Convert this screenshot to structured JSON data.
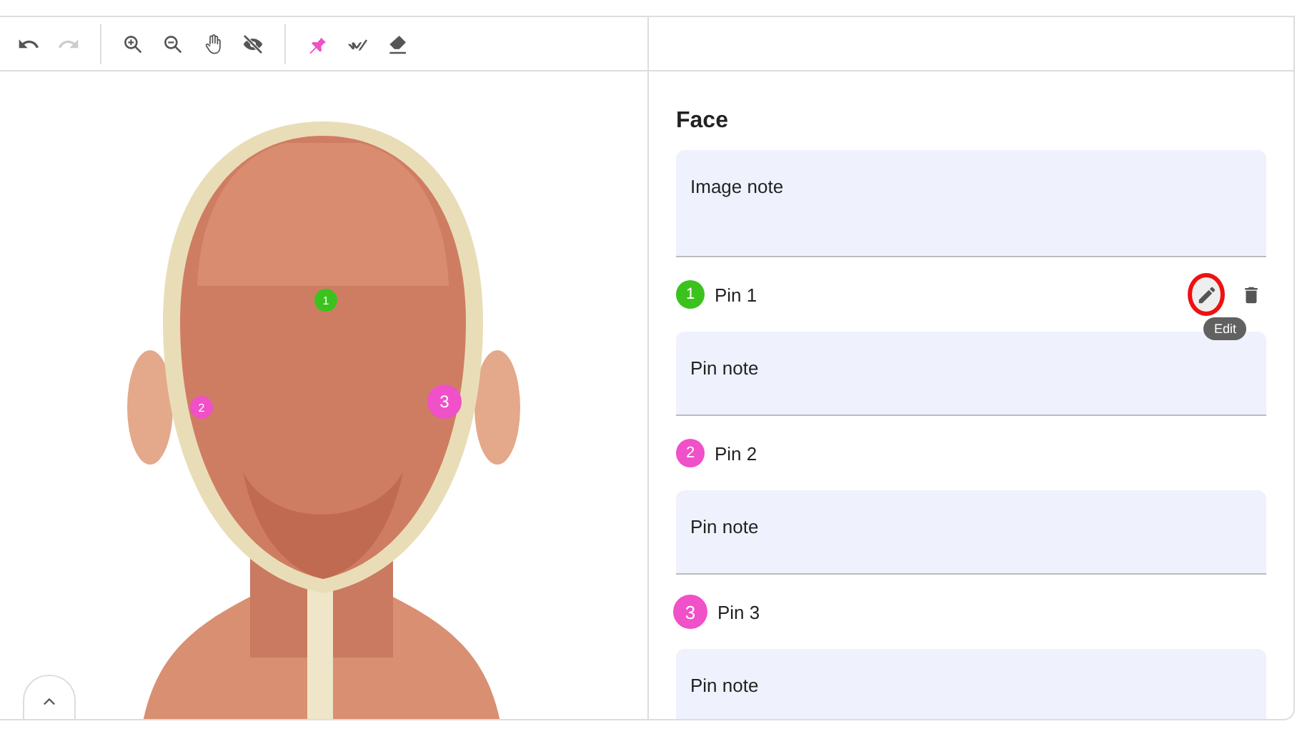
{
  "toolbar": [
    {
      "kind": "undo",
      "disabled": false,
      "selected": false
    },
    {
      "kind": "redo",
      "disabled": true,
      "selected": false
    },
    {
      "kind": "divider"
    },
    {
      "kind": "zoom-in",
      "disabled": false,
      "selected": false
    },
    {
      "kind": "zoom-out",
      "disabled": false,
      "selected": false
    },
    {
      "kind": "pan",
      "disabled": false,
      "selected": false
    },
    {
      "kind": "hide",
      "disabled": false,
      "selected": false
    },
    {
      "kind": "divider"
    },
    {
      "kind": "pin",
      "disabled": false,
      "selected": true
    },
    {
      "kind": "draw",
      "disabled": false,
      "selected": false
    },
    {
      "kind": "erase",
      "disabled": false,
      "selected": false
    }
  ],
  "panel": {
    "title": "Face",
    "image_note": {
      "placeholder": "Image note"
    }
  },
  "markers": [
    {
      "number": "1",
      "color": "#3cc21e",
      "selected": false
    },
    {
      "number": "2",
      "color": "#f050c8",
      "selected": false
    },
    {
      "number": "3",
      "color": "#f050c8",
      "selected": true
    }
  ],
  "pins": [
    {
      "number": "1",
      "label": "Pin 1",
      "color": "#3cc21e",
      "selected": false,
      "note_placeholder": "Pin note",
      "actions": {
        "edit_highlighted": true,
        "tooltip": "Edit"
      }
    },
    {
      "number": "2",
      "label": "Pin 2",
      "color": "#f050c8",
      "selected": false,
      "note_placeholder": "Pin note"
    },
    {
      "number": "3",
      "label": "Pin 3",
      "color": "#f050c8",
      "selected": true,
      "note_placeholder": "Pin note"
    }
  ]
}
